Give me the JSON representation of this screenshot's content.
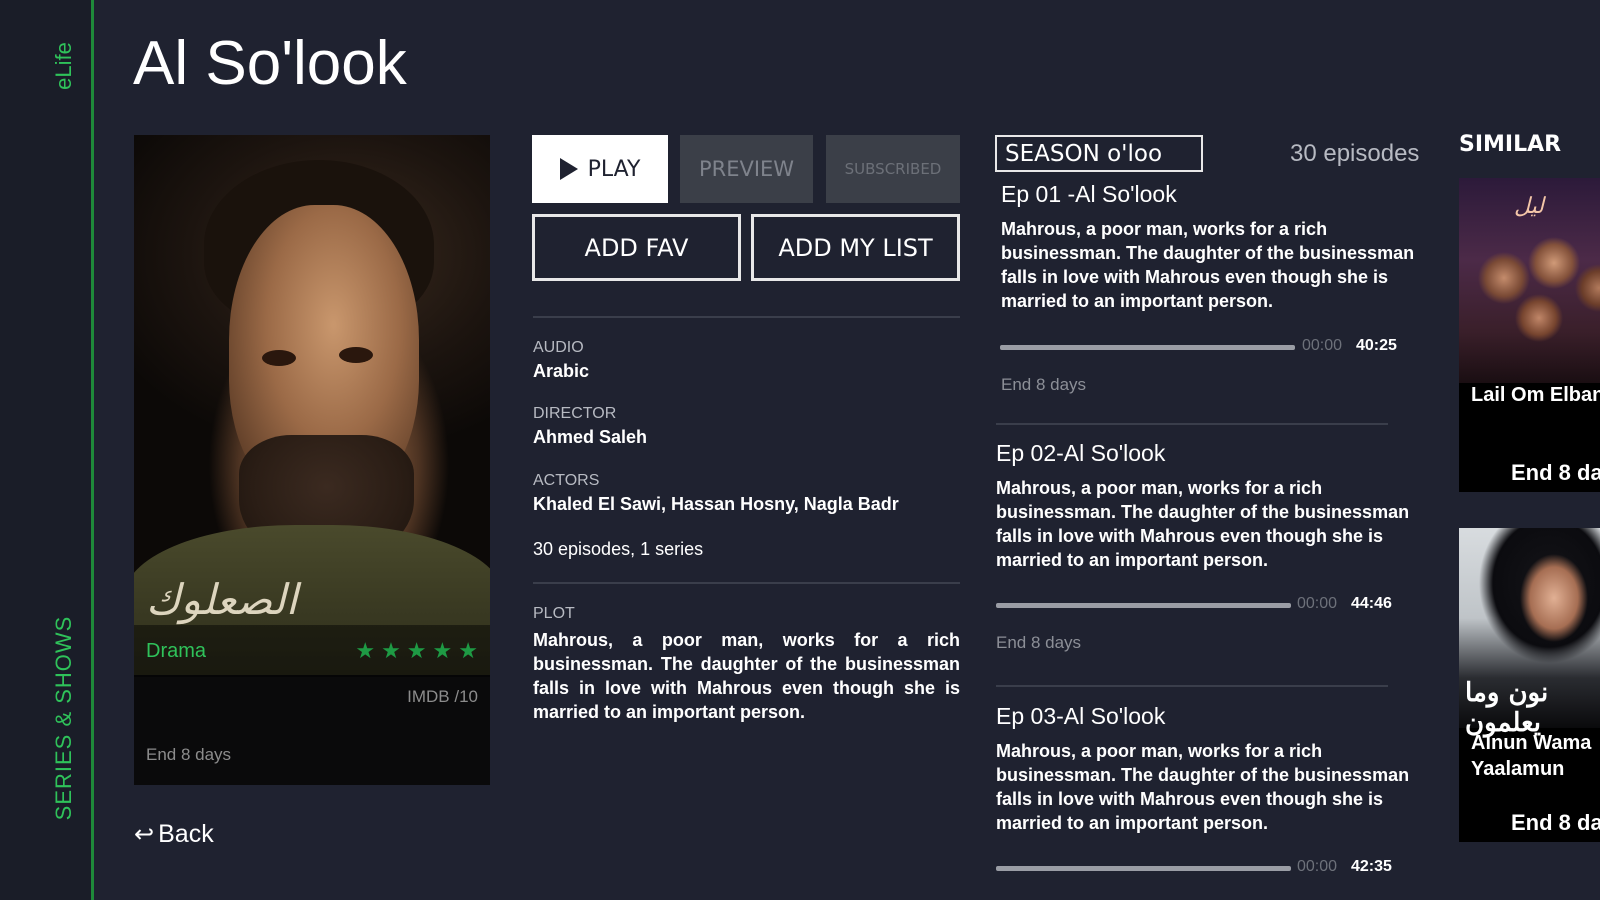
{
  "app": {
    "brand": "eLife",
    "section": "SERIES & SHOWS"
  },
  "title": "Al So'look",
  "poster": {
    "calligraphy": "الصعلوك",
    "genre": "Drama",
    "rating_stars": 5,
    "imdb": "IMDB /10",
    "end": "End 8 days"
  },
  "back": {
    "icon": "back-arrow-icon",
    "label": "Back"
  },
  "buttons": {
    "play": "PLAY",
    "play_icon": "play-icon",
    "preview": "PREVIEW",
    "subscribed": "SUBSCRIBED",
    "add_fav": "ADD FAV",
    "add_my_list": "ADD MY LIST"
  },
  "details": {
    "audio_label": "AUDIO",
    "audio": "Arabic",
    "director_label": "DIRECTOR",
    "director": "Ahmed Saleh",
    "actors_label": "ACTORS",
    "actors": "Khaled El Sawi, Hassan Hosny, Nagla Badr",
    "summary": "30 episodes, 1 series",
    "plot_label": "PLOT",
    "plot": "Mahrous, a poor man, works for a rich businessman. The daughter of the businessman falls in love with Mahrous even though she is married to an important person."
  },
  "season": {
    "selected": "SEASON o'loo",
    "episodes_count": "30 episodes"
  },
  "episodes": [
    {
      "title": "Ep 01 -Al So'look",
      "description": "Mahrous, a poor man, works for a rich businessman. The daughter of the businessman falls in love with Mahrous even though she is married to an important person.",
      "progress": 0,
      "start": "00:00",
      "duration": "40:25",
      "end": "End 8 days"
    },
    {
      "title": "Ep 02-Al So'look",
      "description": "Mahrous, a poor man, works for a rich businessman. The daughter of the businessman falls in love with Mahrous even though she is married to an important person.",
      "progress": 0,
      "start": "00:00",
      "duration": "44:46",
      "end": "End 8 days"
    },
    {
      "title": "Ep 03-Al So'look",
      "description": "Mahrous, a poor man, works for a rich businessman. The daughter of the businessman falls in love with Mahrous even though she is married to an important person.",
      "progress": 0,
      "start": "00:00",
      "duration": "42:35"
    }
  ],
  "similar": {
    "label": "SIMILAR",
    "items": [
      {
        "title": "Lail Om Elban",
        "logo": "ليل",
        "end": "End 8 da"
      },
      {
        "title_line1": "Alnun Wama",
        "title_line2": "Yaalamun",
        "logo": "نون وما يعلمون",
        "end": "End 8 da"
      }
    ]
  },
  "colors": {
    "background": "#1f2230",
    "accent": "#2fc25a",
    "rail": "#1a1d28"
  }
}
